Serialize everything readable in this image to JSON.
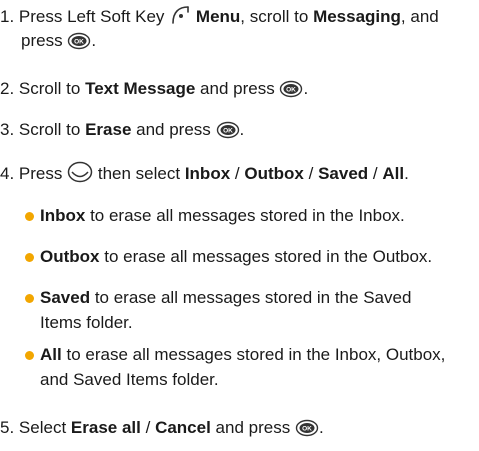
{
  "steps": [
    {
      "number": "1.",
      "t1": "Press Left Soft Key",
      "menu": "Menu",
      "t2": ", scroll to",
      "messaging": "Messaging",
      "t3": ", and",
      "t4": "press",
      "t5": "."
    },
    {
      "number": "2.",
      "t1": "Scroll to",
      "target": "Text Message",
      "t2": "and press",
      "t3": "."
    },
    {
      "number": "3.",
      "t1": "Scroll to",
      "target": "Erase",
      "t2": "and press",
      "t3": "."
    },
    {
      "number": "4.",
      "t1": "Press",
      "t2": "then select",
      "opt1": "Inbox",
      "sep": "/",
      "opt2": "Outbox",
      "opt3": "Saved",
      "opt4": "All",
      "t3": "."
    },
    {
      "number": "5.",
      "t1": "Select",
      "opt1": "Erase all",
      "sep": "/",
      "opt2": "Cancel",
      "t2": "and press",
      "t3": "."
    }
  ],
  "bullets": [
    {
      "term": "Inbox",
      "text": "to erase all messages stored in the Inbox."
    },
    {
      "term": "Outbox",
      "text": "to erase all messages stored in the Outbox."
    },
    {
      "term": "Saved",
      "text": "to erase all messages stored in the Saved",
      "text2": "Items folder."
    },
    {
      "term": "All",
      "text": "to erase all messages stored in the Inbox, Outbox,",
      "text2": "and Saved Items folder."
    }
  ],
  "icons": {
    "ok_key": "OK",
    "soft_key": "left-soft-key-icon",
    "nav_key": "navigation-key-icon"
  },
  "colors": {
    "bullet": "#f2a600",
    "text": "#1a1a1a"
  }
}
